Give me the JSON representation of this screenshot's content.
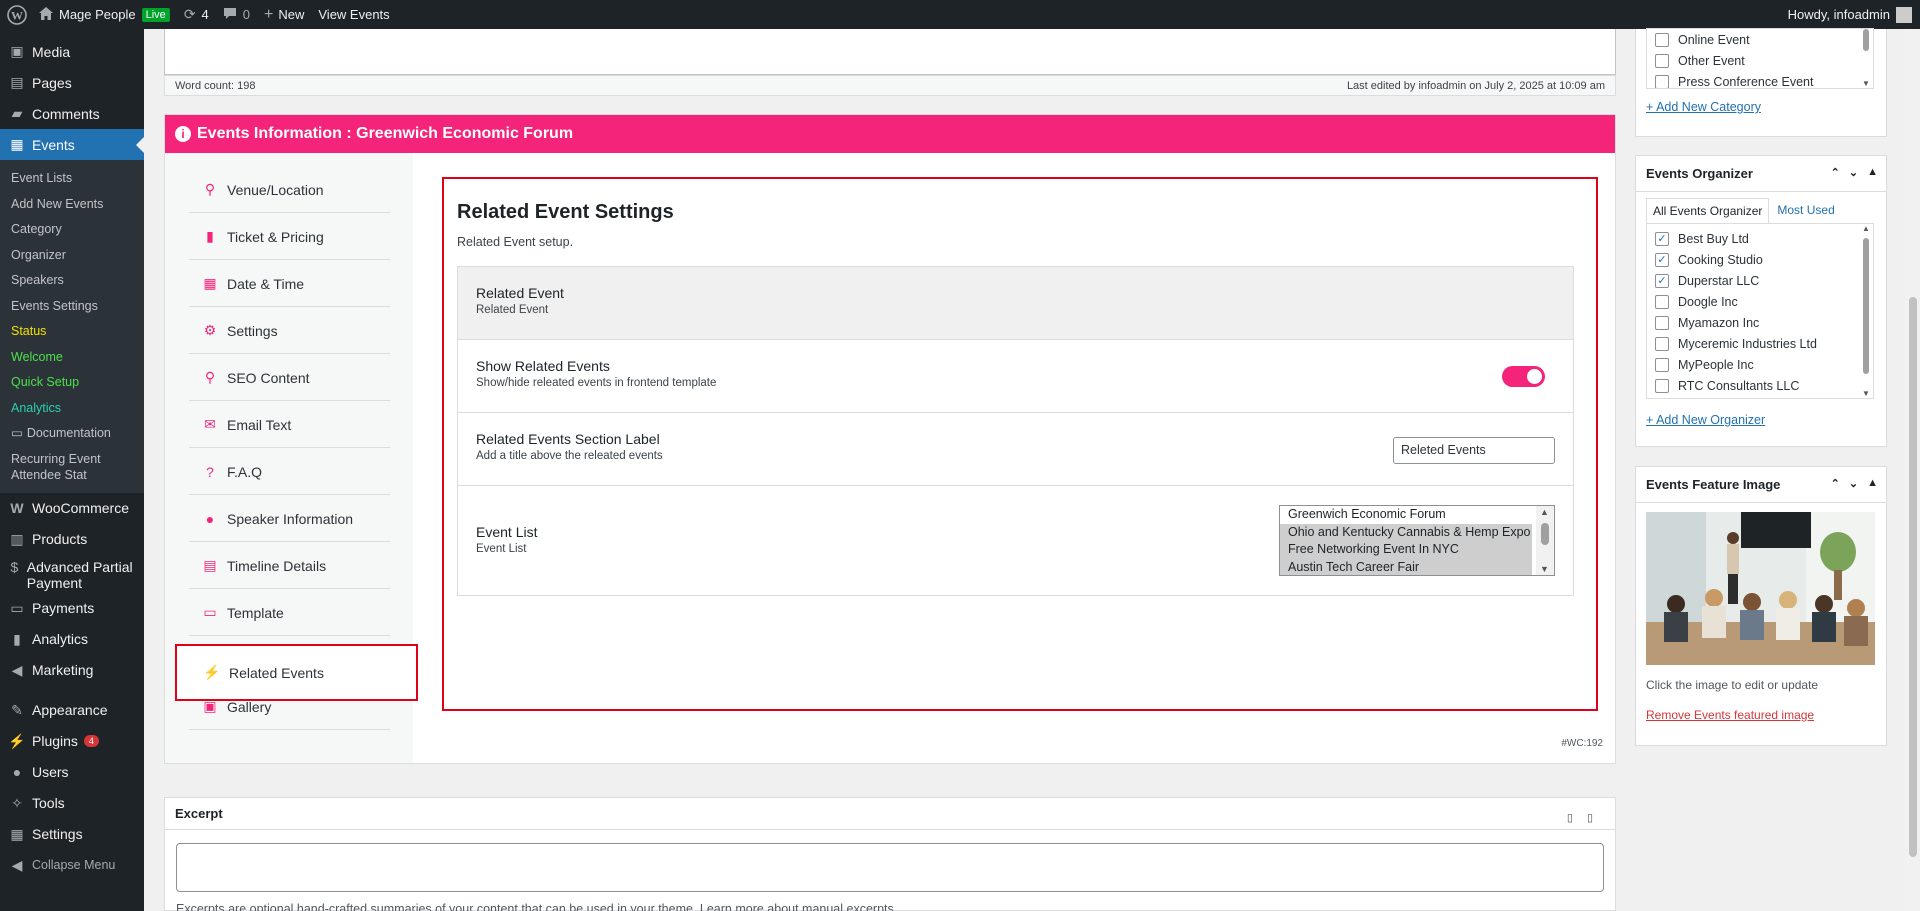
{
  "admin_bar": {
    "site_name": "Mage People",
    "live_badge": "Live",
    "updates_count": "4",
    "comments_count": "0",
    "new_label": "New",
    "view_label": "View Events",
    "greeting": "Howdy, infoadmin"
  },
  "menu": {
    "media": "Media",
    "pages": "Pages",
    "comments": "Comments",
    "events": "Events",
    "submenu": [
      "Event Lists",
      "Add New Events",
      "Category",
      "Organizer",
      "Speakers",
      "Events Settings",
      "Status",
      "Welcome",
      "Quick Setup",
      "Analytics",
      "Documentation",
      "Recurring Event Attendee Stat"
    ],
    "woocommerce": "WooCommerce",
    "products": "Products",
    "advanced_partial": "Advanced Partial Payment",
    "payments": "Payments",
    "analytics": "Analytics",
    "marketing": "Marketing",
    "appearance": "Appearance",
    "plugins": "Plugins",
    "plugins_badge": "4",
    "users": "Users",
    "tools": "Tools",
    "settings": "Settings",
    "collapse": "Collapse Menu"
  },
  "editor_status": {
    "word_count": "Word count: 198",
    "last_edited": "Last edited by infoadmin on July 2, 2025 at 10:09 am"
  },
  "events_box": {
    "header": "Events Information : Greenwich Economic Forum",
    "tabs": [
      "Venue/Location",
      "Ticket & Pricing",
      "Date & Time",
      "Settings",
      "SEO Content",
      "Email Text",
      "F.A.Q",
      "Speaker Information",
      "Timeline Details",
      "Template",
      "Related Events",
      "Gallery"
    ],
    "active_tab": "Related Events",
    "wc_tag": "#WC:192"
  },
  "related_settings": {
    "title": "Related Event Settings",
    "subtitle": "Related Event setup.",
    "section_label": "Related Event",
    "section_desc": "Related Event",
    "show_label": "Show Related Events",
    "show_desc": "Show/hide releated events in frontend template",
    "show_enabled": true,
    "section_title_label": "Related Events Section Label",
    "section_title_desc": "Add a title above the releated events",
    "section_title_value": "Releted Events",
    "event_list_label": "Event List",
    "event_list_desc": "Event List",
    "event_options": [
      {
        "name": "Greenwich Economic Forum",
        "selected": false
      },
      {
        "name": "Ohio and Kentucky Cannabis & Hemp Expo",
        "selected": true
      },
      {
        "name": "Free Networking Event In NYC",
        "selected": true
      },
      {
        "name": "Austin Tech Career Fair",
        "selected": true
      }
    ]
  },
  "excerpt": {
    "title": "Excerpt",
    "help": "Excerpts are optional hand-crafted summaries of your content that can be used in your theme. Learn more about manual excerpts."
  },
  "categories_panel": {
    "items": [
      {
        "name": "Online Event",
        "checked": false
      },
      {
        "name": "Other Event",
        "checked": false
      },
      {
        "name": "Press Conference Event",
        "checked": false
      }
    ],
    "add_link": "+ Add New Category"
  },
  "organizer_panel": {
    "title": "Events Organizer",
    "tab_all": "All Events Organizer",
    "tab_used": "Most Used",
    "items": [
      {
        "name": "Best Buy Ltd",
        "checked": true
      },
      {
        "name": "Cooking Studio",
        "checked": true
      },
      {
        "name": "Duperstar LLC",
        "checked": true
      },
      {
        "name": "Doogle Inc",
        "checked": false
      },
      {
        "name": "Myamazon Inc",
        "checked": false
      },
      {
        "name": "Myceremic Industries Ltd",
        "checked": false
      },
      {
        "name": "MyPeople Inc",
        "checked": false
      },
      {
        "name": "RTC Consultants LLC",
        "checked": false
      }
    ],
    "add_link": "+ Add New Organizer"
  },
  "feature_panel": {
    "title": "Events Feature Image",
    "hint": "Click the image to edit or update",
    "remove_link": "Remove Events featured image"
  },
  "colors": {
    "accent": "#f4247a",
    "highlight_border": "#e0001a",
    "wp_blue": "#2271b1",
    "admin_dark": "#1d2327"
  }
}
